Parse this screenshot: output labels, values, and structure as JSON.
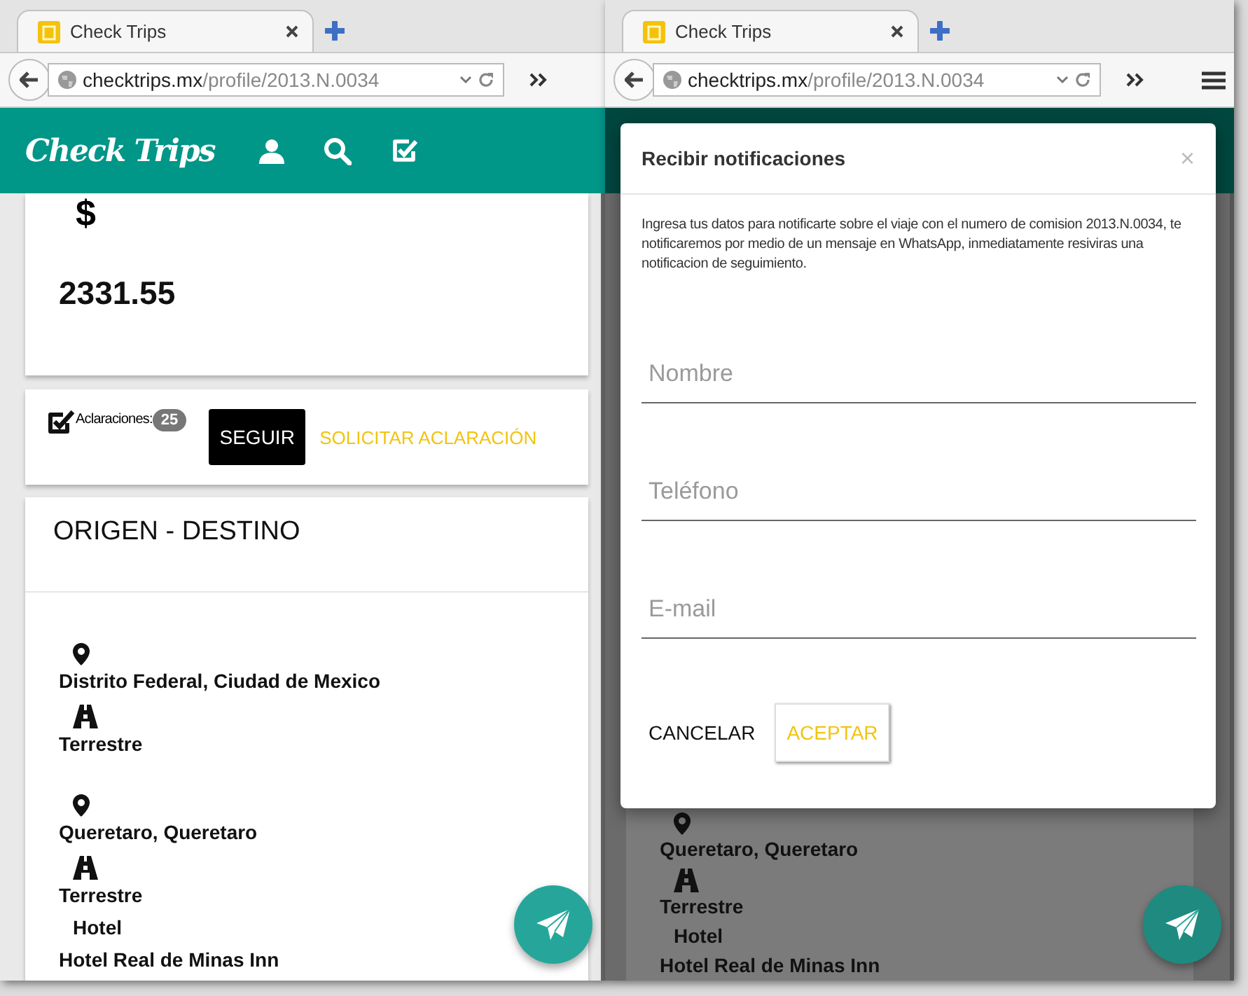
{
  "windows": [
    {
      "tab": {
        "title": "Check Trips"
      },
      "address": {
        "host": "checktrips.mx",
        "path": "/profile/2013.N.0034"
      },
      "page": {
        "navbar": {
          "logo": "Check Trips"
        },
        "price_card": {
          "currency": "$",
          "amount": "2331.55"
        },
        "actions": {
          "label": "Aclaraciones:",
          "count": "25",
          "follow_button": "SEGUIR",
          "request_button": "SOLICITAR ACLARACIÓN"
        },
        "route": {
          "title": "ORIGEN - DESTINO",
          "stops": [
            {
              "kind": "place",
              "text": "Distrito Federal, Ciudad de Mexico"
            },
            {
              "kind": "transport",
              "text": "Terrestre"
            },
            {
              "kind": "place",
              "text": "Queretaro, Queretaro"
            },
            {
              "kind": "transport",
              "text": "Terrestre"
            },
            {
              "kind": "hotel",
              "label": "Hotel",
              "text": "Hotel Real de Minas Inn"
            }
          ]
        }
      }
    },
    {
      "tab": {
        "title": "Check Trips"
      },
      "address": {
        "host": "checktrips.mx",
        "path": "/profile/2013.N.0034"
      },
      "dialog": {
        "title": "Recibir notificaciones",
        "close": "×",
        "message": "Ingresa tus datos para notificarte sobre el viaje con el numero de comision 2013.N.0034, te notificaremos por medio de un mensaje en WhatsApp, inmediatamente resiviras una notificacion de seguimiento.",
        "fields": [
          {
            "placeholder": "Nombre"
          },
          {
            "placeholder": "Teléfono"
          },
          {
            "placeholder": "E-mail"
          }
        ],
        "cancel_button": "CANCELAR",
        "accept_button": "ACEPTAR"
      },
      "page": {
        "route": {
          "stops": [
            {
              "kind": "place",
              "text": "Queretaro, Queretaro"
            },
            {
              "kind": "transport",
              "text": "Terrestre"
            },
            {
              "kind": "hotel",
              "label": "Hotel",
              "text": "Hotel Real de Minas Inn"
            }
          ]
        }
      }
    }
  ]
}
